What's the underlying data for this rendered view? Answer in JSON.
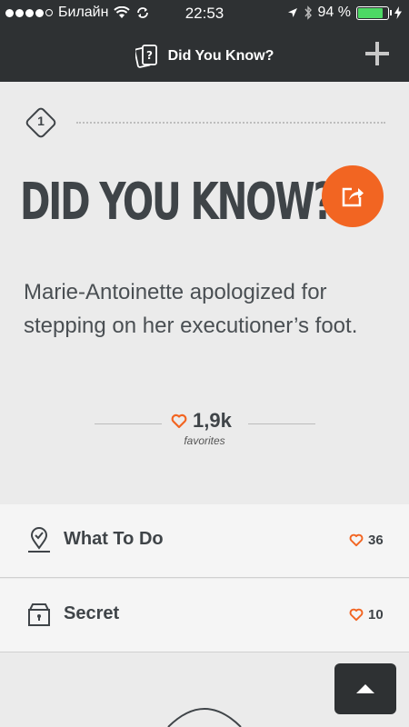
{
  "status": {
    "carrier": "Билайн",
    "time": "22:53",
    "battery": "94 %",
    "battery_level": 0.94
  },
  "nav": {
    "title": "Did You Know?"
  },
  "card": {
    "number": "1",
    "heading": "DID YOU KNOW?",
    "fact": "Marie-Antoinette apologized for stepping on her executioner’s foot.",
    "favorites_count": "1,9k",
    "favorites_label": "favorites"
  },
  "rows": [
    {
      "label": "What To Do",
      "count": "36",
      "icon": "map-pin-icon"
    },
    {
      "label": "Secret",
      "count": "10",
      "icon": "lockbox-icon"
    }
  ],
  "colors": {
    "accent": "#f26522",
    "dark": "#2e3133",
    "background": "#ebebeb"
  }
}
